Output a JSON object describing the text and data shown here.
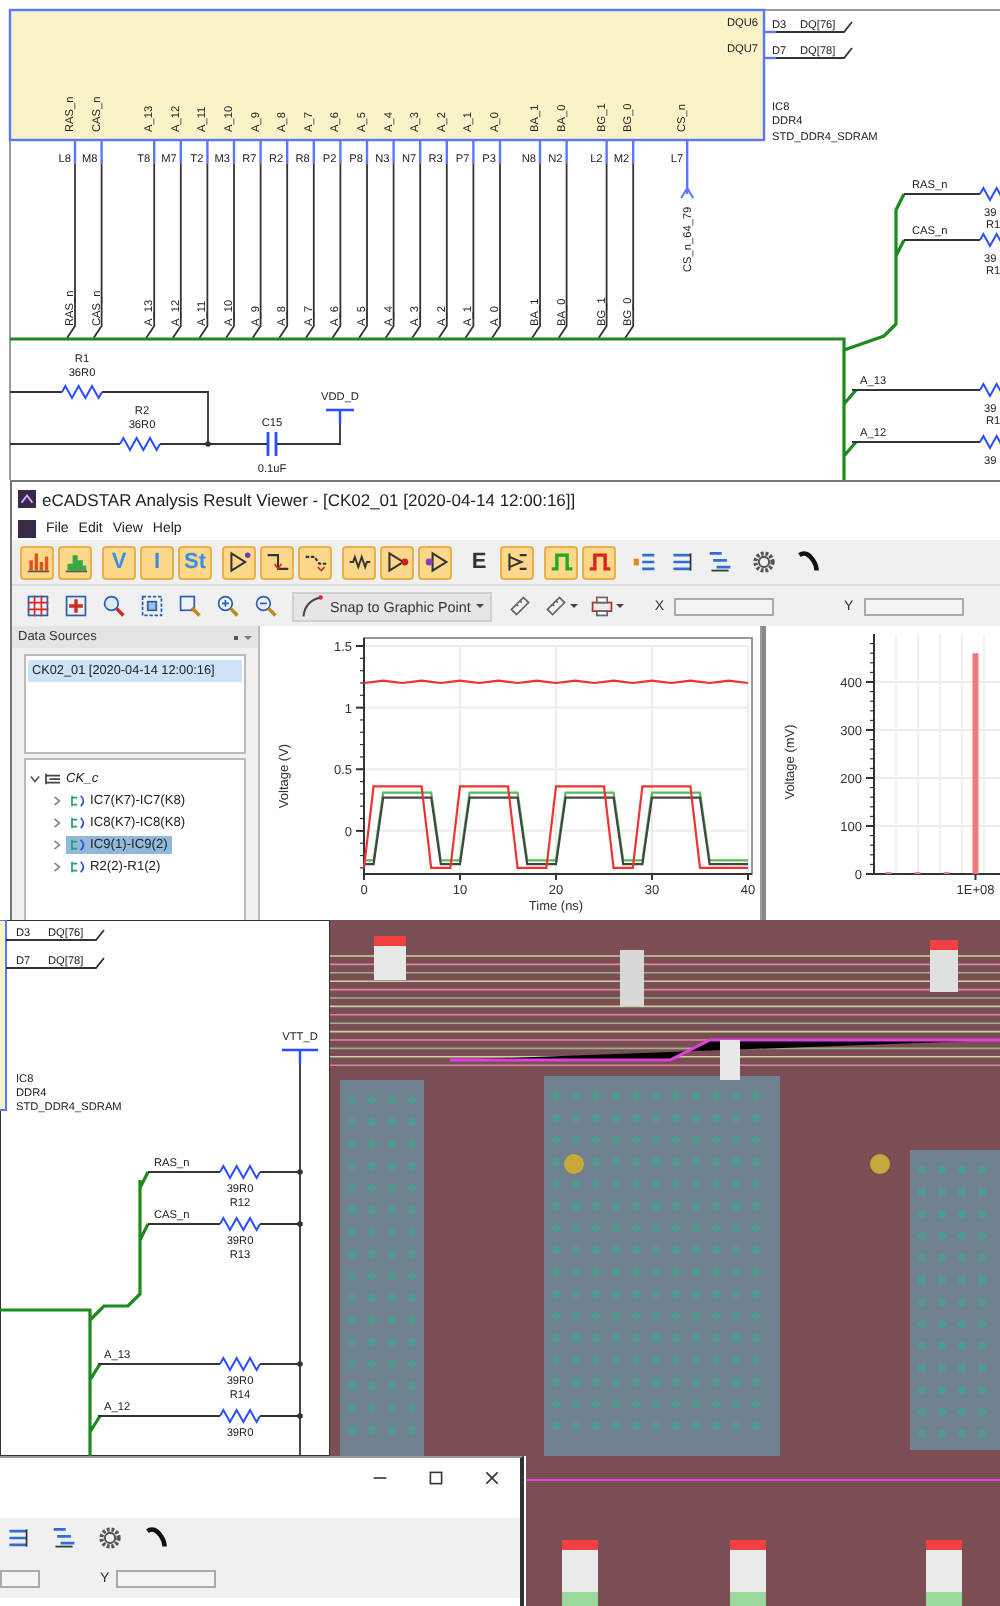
{
  "schematic_top": {
    "component": {
      "ref": "IC8",
      "part": "DDR4",
      "model": "STD_DDR4_SDRAM"
    },
    "data_pins": [
      {
        "name": "DQU6",
        "number": "D3",
        "net": "DQ[76]"
      },
      {
        "name": "DQU7",
        "number": "D7",
        "net": "DQ[78]"
      }
    ],
    "pin_groups": [
      [
        {
          "name": "RAS_n",
          "number": "L8",
          "net": "RAS_n",
          "kind": "bus"
        },
        {
          "name": "CAS_n",
          "number": "M8",
          "net": "CAS_n",
          "kind": "bus"
        }
      ],
      [
        {
          "name": "A_13",
          "number": "T8",
          "net": "A_13",
          "kind": "bus"
        },
        {
          "name": "A_12",
          "number": "M7",
          "net": "A_12",
          "kind": "bus"
        },
        {
          "name": "A_11",
          "number": "T2",
          "net": "A_11",
          "kind": "bus"
        },
        {
          "name": "A_10",
          "number": "M3",
          "net": "A_10",
          "kind": "bus"
        },
        {
          "name": "A_9",
          "number": "R7",
          "net": "A_9",
          "kind": "bus"
        },
        {
          "name": "A_8",
          "number": "R2",
          "net": "A_8",
          "kind": "bus"
        },
        {
          "name": "A_7",
          "number": "R8",
          "net": "A_7",
          "kind": "bus"
        },
        {
          "name": "A_6",
          "number": "P2",
          "net": "A_6",
          "kind": "bus"
        },
        {
          "name": "A_5",
          "number": "P8",
          "net": "A_5",
          "kind": "bus"
        },
        {
          "name": "A_4",
          "number": "N3",
          "net": "A_4",
          "kind": "bus"
        },
        {
          "name": "A_3",
          "number": "N7",
          "net": "A_3",
          "kind": "bus"
        },
        {
          "name": "A_2",
          "number": "R3",
          "net": "A_2",
          "kind": "bus"
        },
        {
          "name": "A_1",
          "number": "P7",
          "net": "A_1",
          "kind": "bus"
        },
        {
          "name": "A_0",
          "number": "P3",
          "net": "A_0",
          "kind": "bus"
        }
      ],
      [
        {
          "name": "BA_1",
          "number": "N8",
          "net": "BA_1",
          "kind": "bus"
        },
        {
          "name": "BA_0",
          "number": "N2",
          "net": "BA_0",
          "kind": "bus"
        }
      ],
      [
        {
          "name": "BG_1",
          "number": "L2",
          "net": "BG_1",
          "kind": "bus"
        },
        {
          "name": "BG_0",
          "number": "M2",
          "net": "BG_0",
          "kind": "bus"
        }
      ],
      [
        {
          "name": "CS_n",
          "number": "L7",
          "net": "CS_n_64_79",
          "kind": "offpage"
        }
      ]
    ],
    "resistors": [
      {
        "ref": "R1",
        "value": "36R0"
      },
      {
        "ref": "R2",
        "value": "36R0"
      }
    ],
    "capacitor": {
      "ref": "C15",
      "value": "0.1uF"
    },
    "power": "VDD_D",
    "terminations": [
      {
        "net": "RAS_n",
        "value": "39",
        "ref": "R1"
      },
      {
        "net": "CAS_n",
        "value": "39",
        "ref": "R1"
      },
      {
        "net": "A_13",
        "value": "39",
        "ref": "R1"
      },
      {
        "net": "A_12",
        "value": "39"
      }
    ]
  },
  "analysis_viewer": {
    "title": "eCADSTAR Analysis Result Viewer - [CK02_01  [2020-04-14 12:00:16]]",
    "menu": [
      "File",
      "Edit",
      "View",
      "Help"
    ],
    "toolbar": [
      [
        {
          "kind": "bars",
          "highlighted": true
        },
        {
          "kind": "histogram",
          "highlighted": true
        }
      ],
      [
        {
          "kind": "letter",
          "label": "V",
          "highlighted": true
        },
        {
          "kind": "letter",
          "label": "I",
          "highlighted": true
        },
        {
          "kind": "letter",
          "label": "St",
          "highlighted": true
        }
      ],
      [
        {
          "kind": "probe",
          "highlighted": true
        },
        {
          "kind": "step",
          "highlighted": true
        },
        {
          "kind": "drop",
          "highlighted": true
        }
      ],
      [
        {
          "kind": "resistor",
          "highlighted": true
        },
        {
          "kind": "buffer",
          "highlighted": true
        },
        {
          "kind": "receiver",
          "highlighted": true
        }
      ],
      [
        {
          "kind": "letter",
          "label": "E",
          "highlighted": false
        },
        {
          "kind": "compare",
          "highlighted": true
        }
      ],
      [
        {
          "kind": "pulse",
          "color": "#22aa22",
          "highlighted": true
        },
        {
          "kind": "pulse",
          "color": "#dd2222",
          "highlighted": true
        }
      ],
      [
        {
          "kind": "stack-in",
          "highlighted": false
        },
        {
          "kind": "stack",
          "highlighted": false
        },
        {
          "kind": "stack-out",
          "highlighted": false
        }
      ],
      [
        {
          "kind": "settings",
          "highlighted": false
        }
      ],
      [
        {
          "kind": "phone",
          "highlighted": false
        }
      ]
    ],
    "toolbar2": [
      {
        "kind": "fit-grid",
        "menu": false
      },
      {
        "kind": "fit-cross",
        "menu": false
      },
      {
        "kind": "zoom-select",
        "menu": false
      },
      {
        "kind": "zoom-box",
        "menu": false
      },
      {
        "kind": "zoom-window",
        "menu": false
      },
      {
        "kind": "zoom-in",
        "menu": false
      },
      {
        "kind": "zoom-out",
        "menu": false
      }
    ],
    "snap_mode": "Snap to Graphic Point",
    "toolbar3": [
      {
        "kind": "ruler",
        "menu": false
      },
      {
        "kind": "ruler",
        "menu": true
      },
      {
        "kind": "printer",
        "menu": true
      }
    ],
    "x_label": "X",
    "y_label": "Y",
    "data_sources": {
      "title": "Data Sources",
      "sources": [
        {
          "label": "CK02_01  [2020-04-14 12:00:16]",
          "selected": true
        }
      ],
      "tree": [
        {
          "label": "CK_c",
          "expanded": true,
          "children": [
            {
              "label": "IC7(K7)-IC7(K8)",
              "expanded": false,
              "selected": false
            },
            {
              "label": "IC8(K7)-IC8(K8)",
              "expanded": false,
              "selected": false
            },
            {
              "label": "IC9(1)-IC9(2)",
              "expanded": false,
              "selected": true
            },
            {
              "label": "R2(2)-R1(2)",
              "expanded": false,
              "selected": false
            }
          ]
        }
      ]
    },
    "waveform_panel": {
      "chart_data": {
        "type": "line",
        "xlabel": "Time (ns)",
        "ylabel": "Voltage (V)",
        "x": [
          0,
          1,
          2,
          3,
          4,
          5,
          6,
          7,
          8,
          9,
          10,
          11,
          12,
          13,
          14,
          15,
          16,
          17,
          18,
          19,
          20,
          21,
          22,
          23,
          24,
          25,
          26,
          27,
          28,
          29,
          30,
          31,
          32,
          33,
          34,
          35,
          36,
          37,
          38,
          39,
          40
        ],
        "xlim": [
          0,
          40
        ],
        "ylim": [
          -0.35,
          1.5
        ],
        "xticks": [
          0,
          10,
          20,
          30,
          40
        ],
        "yticks": [
          0,
          0.5,
          1,
          1.5
        ],
        "grid": true,
        "series": [
          {
            "color": "#ee3333",
            "values": [
              1.2,
              1.21,
              1.22,
              1.21,
              1.2,
              1.21,
              1.22,
              1.21,
              1.2,
              1.21,
              1.22,
              1.21,
              1.2,
              1.21,
              1.22,
              1.21,
              1.2,
              1.21,
              1.22,
              1.21,
              1.2,
              1.21,
              1.22,
              1.21,
              1.2,
              1.21,
              1.22,
              1.21,
              1.2,
              1.21,
              1.22,
              1.21,
              1.2,
              1.21,
              1.22,
              1.21,
              1.2,
              1.21,
              1.22,
              1.21,
              1.2
            ]
          },
          {
            "color": "#55bb55",
            "values": [
              -0.24,
              -0.24,
              0.31,
              0.31,
              0.31,
              0.31,
              0.31,
              0.31,
              -0.24,
              -0.24,
              -0.24,
              0.31,
              0.31,
              0.31,
              0.31,
              0.31,
              0.31,
              -0.24,
              -0.24,
              -0.24,
              -0.24,
              0.31,
              0.31,
              0.31,
              0.31,
              0.31,
              0.31,
              -0.24,
              -0.24,
              -0.24,
              0.31,
              0.31,
              0.31,
              0.31,
              0.31,
              0.31,
              -0.24,
              -0.24,
              -0.24,
              -0.24,
              -0.24
            ]
          },
          {
            "color": "#444444",
            "values": [
              -0.27,
              -0.27,
              0.27,
              0.27,
              0.27,
              0.27,
              0.27,
              0.27,
              -0.27,
              -0.27,
              -0.27,
              0.27,
              0.27,
              0.27,
              0.27,
              0.27,
              0.27,
              -0.27,
              -0.27,
              -0.27,
              -0.27,
              0.27,
              0.27,
              0.27,
              0.27,
              0.27,
              0.27,
              -0.27,
              -0.27,
              -0.27,
              0.27,
              0.27,
              0.27,
              0.27,
              0.27,
              0.27,
              -0.27,
              -0.27,
              -0.27,
              -0.27,
              -0.27
            ]
          },
          {
            "color": "#ee3333",
            "values": [
              -0.3,
              0.36,
              0.36,
              0.36,
              0.36,
              0.36,
              0.36,
              -0.3,
              -0.3,
              -0.3,
              0.36,
              0.36,
              0.36,
              0.36,
              0.36,
              0.36,
              -0.3,
              -0.3,
              -0.3,
              -0.3,
              0.36,
              0.36,
              0.36,
              0.36,
              0.36,
              0.36,
              -0.3,
              -0.3,
              -0.3,
              0.36,
              0.36,
              0.36,
              0.36,
              0.36,
              0.36,
              -0.3,
              -0.3,
              -0.3,
              -0.3,
              -0.3,
              -0.3
            ]
          }
        ]
      }
    },
    "spectrum_panel": {
      "chart_data": {
        "type": "bar",
        "ylabel": "Voltage (mV)",
        "categories": [
          null,
          null,
          null,
          "1E+08"
        ],
        "values": [
          4,
          4,
          4,
          460
        ],
        "ylim": [
          0,
          500
        ],
        "yticks": [
          0,
          100,
          200,
          300,
          400
        ],
        "grid": true
      }
    }
  },
  "schematic_detail": {
    "data_pins": [
      {
        "number": "D3",
        "net": "DQ[76]"
      },
      {
        "number": "D7",
        "net": "DQ[78]"
      }
    ],
    "component": {
      "ref": "IC8",
      "part": "DDR4",
      "model": "STD_DDR4_SDRAM"
    },
    "power": "VTT_D",
    "terminations": [
      {
        "net": "RAS_n",
        "value": "39R0",
        "ref": "R12"
      },
      {
        "net": "CAS_n",
        "value": "39R0",
        "ref": "R13"
      },
      {
        "net": "A_13",
        "value": "39R0",
        "ref": "R14"
      },
      {
        "net": "A_12",
        "value": "39R0"
      }
    ]
  },
  "viewer_fragment": {
    "toolbar": [
      {
        "kind": "stack"
      },
      {
        "kind": "stack-out"
      },
      {
        "kind": "settings"
      },
      {
        "kind": "phone"
      }
    ],
    "y_label": "Y"
  }
}
